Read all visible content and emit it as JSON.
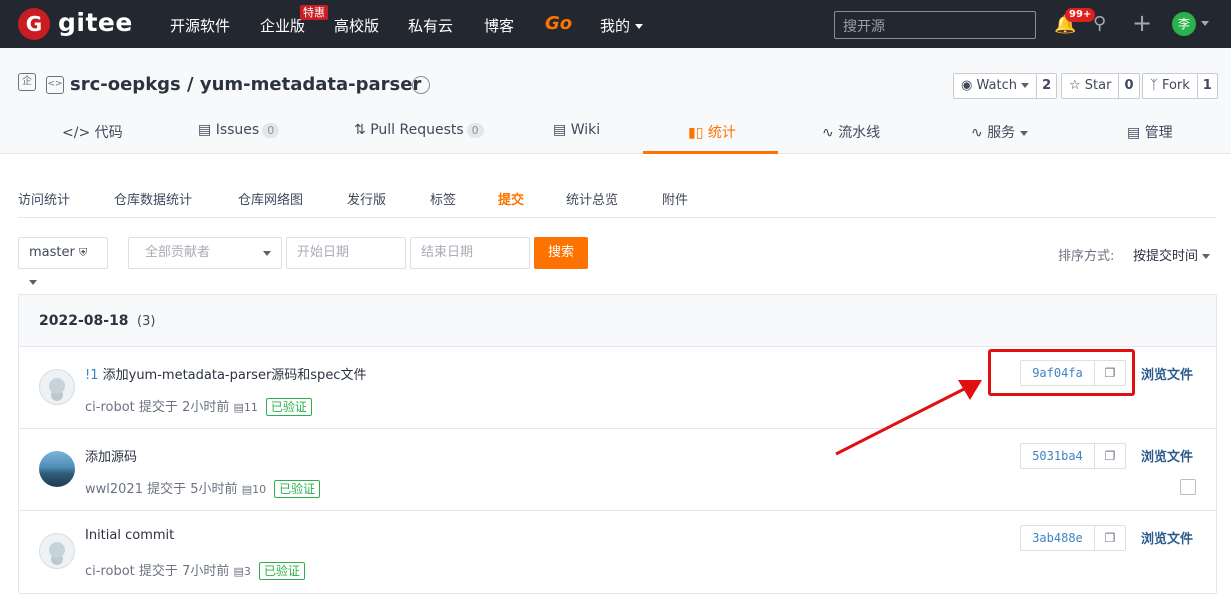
{
  "topbar": {
    "logo_letter": "G",
    "brand": "gitee",
    "nav": [
      "开源软件",
      "企业版",
      "高校版",
      "私有云",
      "博客",
      "Go",
      "我的"
    ],
    "hot_badge": "特惠",
    "search_placeholder": "搜开源",
    "notif_count": "99+",
    "avatar_letter": "李"
  },
  "repo": {
    "ent_icon": "企",
    "title": "src-oepkgs / yum-metadata-parser",
    "watch_label": "Watch",
    "watch_count": "2",
    "star_label": "Star",
    "star_count": "0",
    "fork_label": "Fork",
    "fork_count": "1"
  },
  "tabs": [
    {
      "label": "代码",
      "icon": "code-icon"
    },
    {
      "label": "Issues",
      "count": "0",
      "icon": "issues-icon"
    },
    {
      "label": "Pull Requests",
      "count": "0",
      "icon": "pr-icon"
    },
    {
      "label": "Wiki",
      "icon": "wiki-icon"
    },
    {
      "label": "统计",
      "icon": "chart-icon",
      "active": true
    },
    {
      "label": "流水线",
      "icon": "pipeline-icon"
    },
    {
      "label": "服务",
      "icon": "service-icon"
    },
    {
      "label": "管理",
      "icon": "manage-icon"
    }
  ],
  "subnav": [
    "访问统计",
    "仓库数据统计",
    "仓库网络图",
    "发行版",
    "标签",
    "提交",
    "统计总览",
    "附件"
  ],
  "filters": {
    "branch": "master",
    "contributors_placeholder": "全部贡献者",
    "start_placeholder": "开始日期",
    "end_placeholder": "结束日期",
    "search_label": "搜索",
    "sort_label": "排序方式:",
    "sort_value": "按提交时间"
  },
  "commits": {
    "date": "2022-08-18",
    "count": "(3)",
    "browse_label": "浏览文件",
    "verified_label": "已验证",
    "commit_word": "提交于",
    "items": [
      {
        "pr": "!1",
        "message": "添加yum-metadata-parser源码和spec文件",
        "author": "ci-robot",
        "time": "2小时前",
        "comments": "11",
        "sha": "9af04fa"
      },
      {
        "pr": "",
        "message": "添加源码",
        "author": "wwl2021",
        "time": "5小时前",
        "comments": "10",
        "sha": "5031ba4"
      },
      {
        "pr": "",
        "message": "Initial commit",
        "author": "ci-robot",
        "time": "7小时前",
        "comments": "3",
        "sha": "3ab488e"
      }
    ]
  },
  "colors": {
    "accent": "#fe7300",
    "topbar": "#23272f",
    "brand_red": "#c71d23",
    "verified_green": "#2bb24c",
    "annotation_red": "#e01010"
  }
}
